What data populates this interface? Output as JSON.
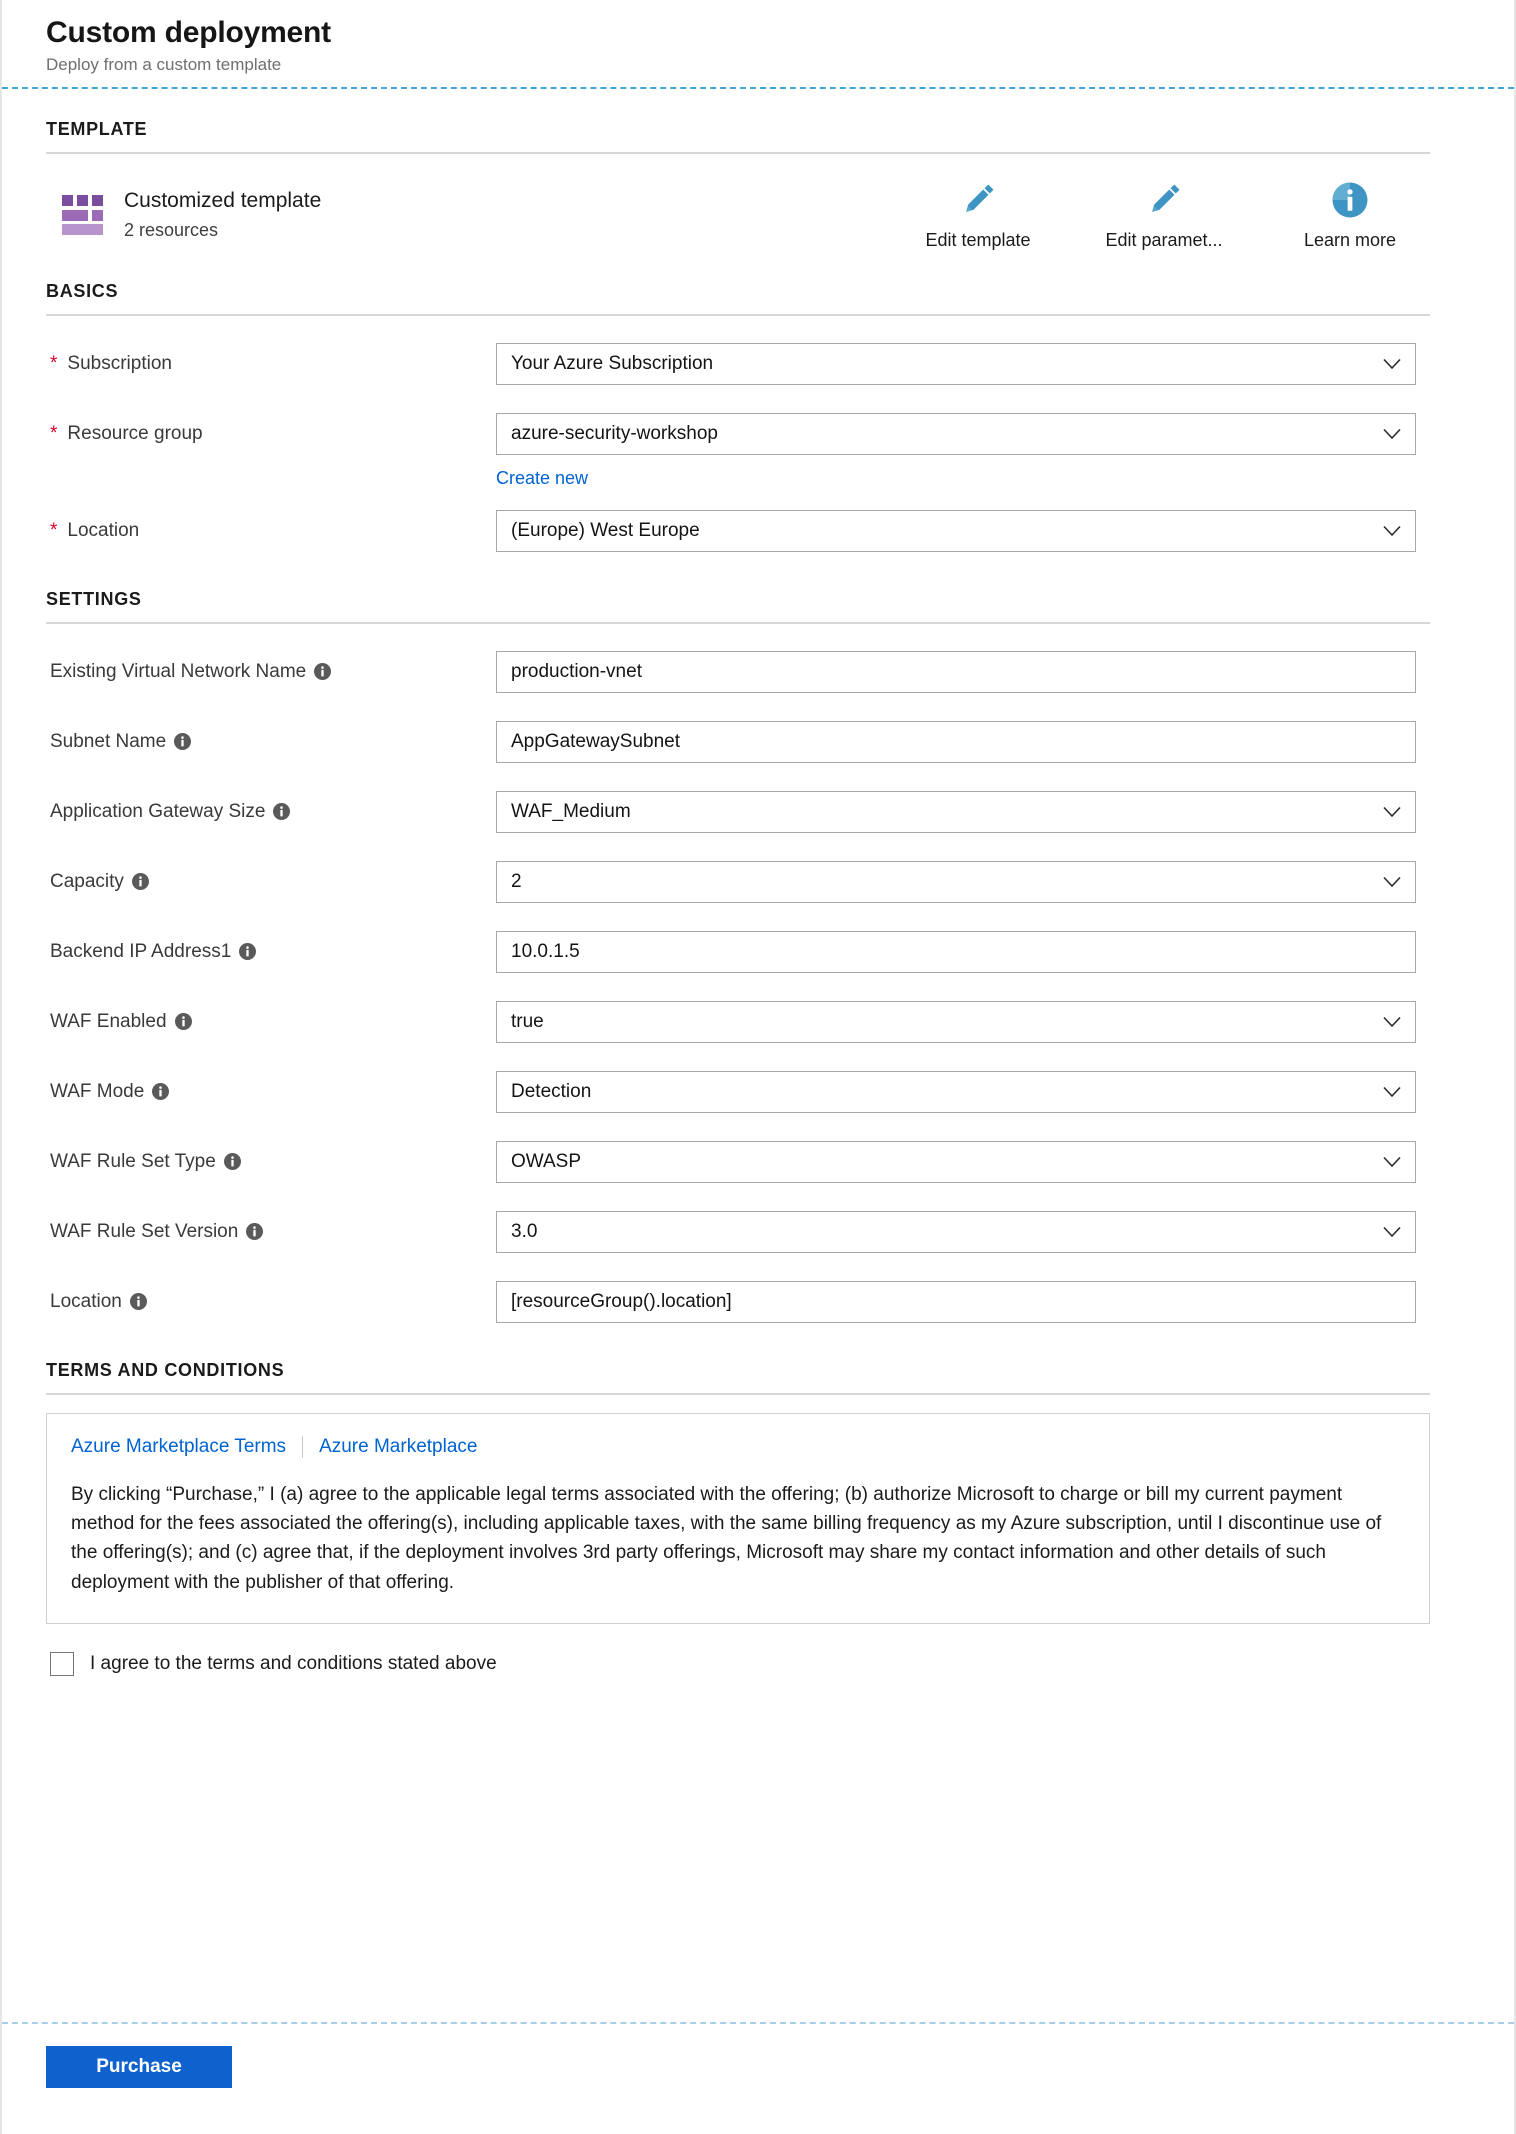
{
  "header": {
    "title": "Custom deployment",
    "subtitle": "Deploy from a custom template"
  },
  "template_section": {
    "heading": "TEMPLATE",
    "icon": "template-grid-icon",
    "name": "Customized template",
    "resource_count": "2 resources",
    "actions": [
      {
        "label": "Edit template",
        "icon": "pencil-icon"
      },
      {
        "label": "Edit paramet...",
        "icon": "pencil-icon"
      },
      {
        "label": "Learn more",
        "icon": "info-circle-icon"
      }
    ]
  },
  "basics_section": {
    "heading": "BASICS",
    "fields": [
      {
        "label": "Subscription",
        "required": true,
        "value": "Your Azure Subscription",
        "type": "select"
      },
      {
        "label": "Resource group",
        "required": true,
        "value": "azure-security-workshop",
        "type": "select",
        "sub_link": "Create new"
      },
      {
        "label": "Location",
        "required": true,
        "value": "(Europe) West Europe",
        "type": "select"
      }
    ]
  },
  "settings_section": {
    "heading": "SETTINGS",
    "fields": [
      {
        "label": "Existing Virtual Network Name",
        "value": "production-vnet",
        "type": "text"
      },
      {
        "label": "Subnet Name",
        "value": "AppGatewaySubnet",
        "type": "text"
      },
      {
        "label": "Application Gateway Size",
        "value": "WAF_Medium",
        "type": "select"
      },
      {
        "label": "Capacity",
        "value": "2",
        "type": "select"
      },
      {
        "label": "Backend IP Address1",
        "value": "10.0.1.5",
        "type": "text"
      },
      {
        "label": "WAF Enabled",
        "value": "true",
        "type": "select"
      },
      {
        "label": "WAF Mode",
        "value": "Detection",
        "type": "select"
      },
      {
        "label": "WAF Rule Set Type",
        "value": "OWASP",
        "type": "select"
      },
      {
        "label": "WAF Rule Set Version",
        "value": "3.0",
        "type": "select"
      },
      {
        "label": "Location",
        "value": "[resourceGroup().location]",
        "type": "text"
      }
    ]
  },
  "terms_section": {
    "heading": "TERMS AND CONDITIONS",
    "links": [
      "Azure Marketplace Terms",
      "Azure Marketplace"
    ],
    "body": "By clicking “Purchase,” I (a) agree to the applicable legal terms associated with the offering; (b) authorize Microsoft to charge or bill my current payment method for the fees associated the offering(s), including applicable taxes, with the same billing frequency as my Azure subscription, until I discontinue use of the offering(s); and (c) agree that, if the deployment involves 3rd party offerings, Microsoft may share my contact information and other details of such deployment with the publisher of that offering.",
    "agree_label": "I agree to the terms and conditions stated above",
    "agree_checked": false
  },
  "footer": {
    "purchase_label": "Purchase"
  },
  "colors": {
    "accent_blue": "#0f62cd",
    "link_blue": "#0063d1",
    "icon_blue": "#3e95c4",
    "required_red": "#d6002a",
    "template_purple_dark": "#7a4e9e",
    "template_purple_mid": "#9b6bb5",
    "template_purple_light": "#b894cd",
    "info_gray": "#5a5a5a"
  }
}
